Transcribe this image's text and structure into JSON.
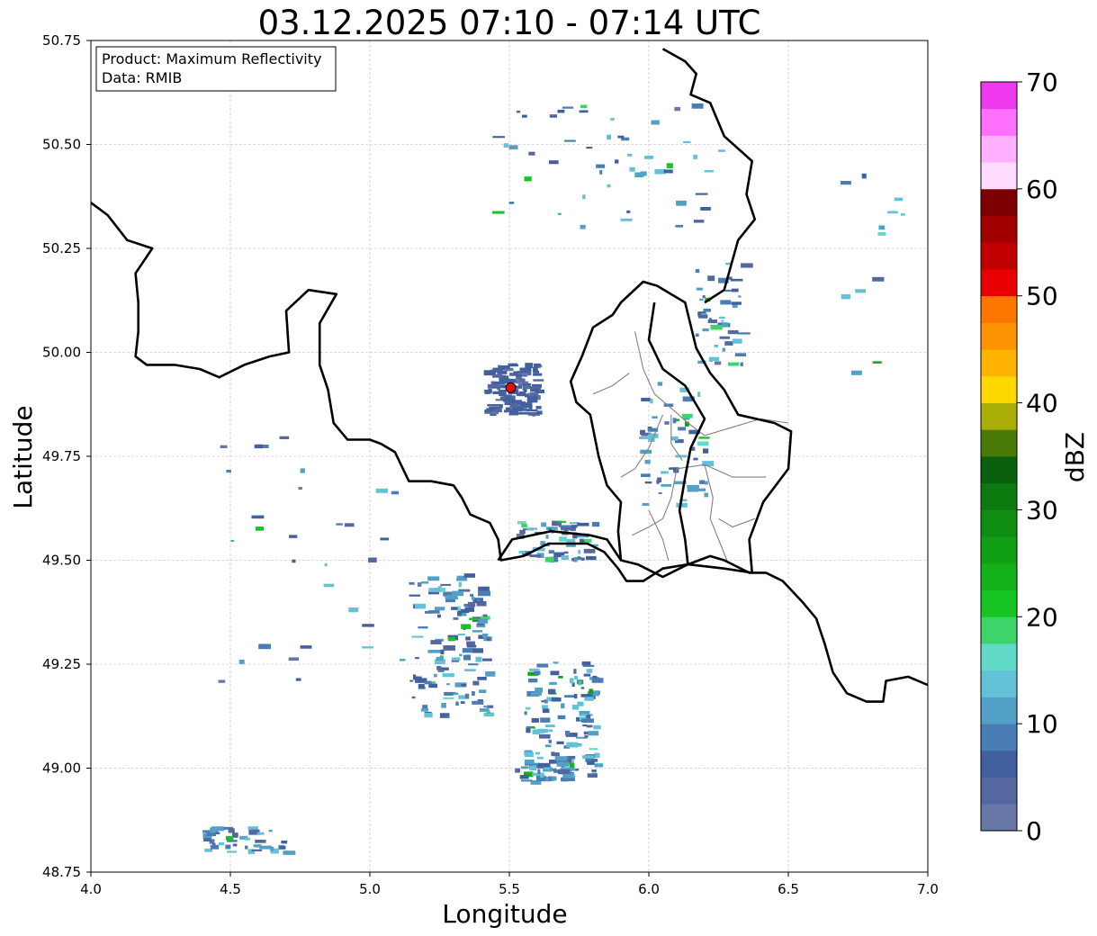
{
  "title": "03.12.2025 07:10 - 07:14 UTC",
  "info_box": {
    "product_line": "Product: Maximum Reflectivity",
    "data_line": "Data: RMIB"
  },
  "xlabel": "Longitude",
  "ylabel": "Latitude",
  "colorbar": {
    "label": "dBZ",
    "min": 0,
    "max": 70,
    "step": 2.5,
    "tick_labels": [
      "0",
      "10",
      "20",
      "30",
      "40",
      "50",
      "60",
      "70"
    ],
    "colors": [
      "#6676a6",
      "#54679f",
      "#43609e",
      "#4a7db3",
      "#53a0c6",
      "#63c2d8",
      "#61dac7",
      "#3dd46a",
      "#17c522",
      "#13b21b",
      "#11a015",
      "#0f8c12",
      "#0d7a0f",
      "#0a600c",
      "#4a7a08",
      "#a9ae06",
      "#ffd800",
      "#fdb300",
      "#fd9300",
      "#fd7600",
      "#e80000",
      "#c30000",
      "#a20000",
      "#7c0000",
      "#ffdbff",
      "#ffb0ff",
      "#ff70ff",
      "#ef39ef"
    ]
  },
  "chart_data": {
    "type": "map",
    "xlim": [
      4.0,
      7.0
    ],
    "ylim": [
      48.75,
      50.75
    ],
    "x_ticks": [
      "4.0",
      "4.5",
      "5.0",
      "5.5",
      "6.0",
      "6.5",
      "7.0"
    ],
    "y_ticks": [
      "48.75",
      "49.00",
      "49.25",
      "49.50",
      "49.75",
      "50.00",
      "50.25",
      "50.50",
      "50.75"
    ],
    "grid": true,
    "radar_site": {
      "lon": 5.505,
      "lat": 49.915,
      "color": "#e01010"
    },
    "echo_regions": [
      {
        "name": "band-southwest",
        "lon": 5.28,
        "lat": 49.3,
        "lon_span": 0.28,
        "lat_span": 0.35,
        "density": 130,
        "max_dbz": 22
      },
      {
        "name": "ring-south",
        "lon": 5.68,
        "lat": 49.12,
        "lon_span": 0.26,
        "lat_span": 0.28,
        "density": 120,
        "max_dbz": 28
      },
      {
        "name": "south-arc",
        "lon": 5.62,
        "lat": 49.0,
        "lon_span": 0.2,
        "lat_span": 0.06,
        "density": 40,
        "max_dbz": 26
      },
      {
        "name": "border-band",
        "lon": 5.65,
        "lat": 49.55,
        "lon_span": 0.3,
        "lat_span": 0.1,
        "density": 60,
        "max_dbz": 22
      },
      {
        "name": "luxembourg-cells",
        "lon": 6.08,
        "lat": 49.78,
        "lon_span": 0.24,
        "lat_span": 0.3,
        "density": 55,
        "max_dbz": 26
      },
      {
        "name": "eifel-cells",
        "lon": 6.25,
        "lat": 50.1,
        "lon_span": 0.18,
        "lat_span": 0.25,
        "density": 45,
        "max_dbz": 26
      },
      {
        "name": "clutter-site",
        "lon": 5.505,
        "lat": 49.915,
        "lon_span": 0.2,
        "lat_span": 0.12,
        "density": 120,
        "max_dbz": 6
      },
      {
        "name": "north-scatter",
        "lon": 5.8,
        "lat": 50.45,
        "lon_span": 0.9,
        "lat_span": 0.3,
        "density": 50,
        "max_dbz": 22
      },
      {
        "name": "west-scatter",
        "lon": 4.8,
        "lat": 49.5,
        "lon_span": 0.7,
        "lat_span": 0.6,
        "density": 30,
        "max_dbz": 22
      },
      {
        "name": "southwest-corner",
        "lon": 4.55,
        "lat": 48.83,
        "lon_span": 0.3,
        "lat_span": 0.06,
        "density": 40,
        "max_dbz": 22
      },
      {
        "name": "east-scatter",
        "lon": 6.8,
        "lat": 50.2,
        "lon_span": 0.25,
        "lat_span": 0.5,
        "density": 12,
        "max_dbz": 24
      }
    ],
    "borders": {
      "national": [
        [
          [
            4.0,
            50.36
          ],
          [
            4.06,
            50.33
          ],
          [
            4.13,
            50.27
          ],
          [
            4.22,
            50.25
          ],
          [
            4.16,
            50.19
          ],
          [
            4.17,
            50.12
          ],
          [
            4.17,
            50.05
          ],
          [
            4.16,
            49.99
          ],
          [
            4.2,
            49.97
          ],
          [
            4.3,
            49.97
          ],
          [
            4.39,
            49.96
          ],
          [
            4.46,
            49.94
          ],
          [
            4.55,
            49.97
          ],
          [
            4.64,
            49.99
          ],
          [
            4.71,
            50.0
          ],
          [
            4.7,
            50.1
          ],
          [
            4.78,
            50.15
          ],
          [
            4.88,
            50.14
          ],
          [
            4.82,
            50.07
          ],
          [
            4.82,
            49.97
          ],
          [
            4.85,
            49.91
          ],
          [
            4.87,
            49.83
          ],
          [
            4.92,
            49.79
          ],
          [
            5.0,
            49.79
          ],
          [
            5.04,
            49.78
          ],
          [
            5.09,
            49.76
          ],
          [
            5.14,
            49.69
          ],
          [
            5.22,
            49.69
          ],
          [
            5.3,
            49.68
          ],
          [
            5.33,
            49.65
          ],
          [
            5.36,
            49.61
          ],
          [
            5.43,
            49.59
          ],
          [
            5.46,
            49.55
          ],
          [
            5.47,
            49.5
          ],
          [
            5.55,
            49.51
          ],
          [
            5.64,
            49.54
          ],
          [
            5.7,
            49.54
          ],
          [
            5.78,
            49.54
          ],
          [
            5.84,
            49.52
          ],
          [
            5.89,
            49.48
          ],
          [
            5.92,
            49.45
          ],
          [
            5.98,
            49.45
          ],
          [
            6.05,
            49.48
          ],
          [
            6.14,
            49.49
          ],
          [
            6.22,
            49.51
          ],
          [
            6.27,
            49.5
          ],
          [
            6.36,
            49.47
          ],
          [
            6.42,
            49.47
          ],
          [
            6.48,
            49.45
          ],
          [
            6.55,
            49.4
          ],
          [
            6.6,
            49.36
          ],
          [
            6.63,
            49.3
          ],
          [
            6.66,
            49.23
          ],
          [
            6.71,
            49.18
          ],
          [
            6.78,
            49.16
          ],
          [
            6.84,
            49.16
          ],
          [
            6.85,
            49.21
          ],
          [
            6.93,
            49.22
          ],
          [
            7.0,
            49.2
          ]
        ],
        [
          [
            5.46,
            49.5
          ],
          [
            5.51,
            49.55
          ],
          [
            5.65,
            49.57
          ],
          [
            5.79,
            49.56
          ],
          [
            5.85,
            49.55
          ],
          [
            5.9,
            49.5
          ],
          [
            5.96,
            49.49
          ],
          [
            6.05,
            49.46
          ],
          [
            6.14,
            49.49
          ]
        ],
        [
          [
            6.14,
            49.49
          ],
          [
            6.27,
            49.48
          ],
          [
            6.37,
            49.47
          ]
        ],
        [
          [
            6.37,
            49.47
          ],
          [
            6.36,
            49.55
          ],
          [
            6.41,
            49.64
          ],
          [
            6.5,
            49.72
          ],
          [
            6.51,
            49.81
          ],
          [
            6.45,
            49.83
          ],
          [
            6.32,
            49.85
          ],
          [
            6.27,
            49.91
          ],
          [
            6.22,
            49.95
          ],
          [
            6.17,
            50.01
          ],
          [
            6.13,
            50.12
          ],
          [
            6.03,
            50.16
          ],
          [
            5.98,
            50.17
          ],
          [
            5.9,
            50.12
          ],
          [
            5.87,
            50.09
          ],
          [
            5.8,
            50.06
          ],
          [
            5.76,
            49.99
          ],
          [
            5.72,
            49.93
          ],
          [
            5.74,
            49.88
          ],
          [
            5.79,
            49.85
          ],
          [
            5.82,
            49.75
          ],
          [
            5.85,
            49.68
          ],
          [
            5.9,
            49.64
          ],
          [
            5.89,
            49.57
          ],
          [
            5.9,
            49.5
          ]
        ],
        [
          [
            6.2,
            50.12
          ],
          [
            6.27,
            50.15
          ],
          [
            6.32,
            50.27
          ],
          [
            6.38,
            50.32
          ],
          [
            6.35,
            50.38
          ],
          [
            6.37,
            50.46
          ],
          [
            6.27,
            50.52
          ],
          [
            6.22,
            50.6
          ],
          [
            6.15,
            50.62
          ],
          [
            6.17,
            50.67
          ],
          [
            6.13,
            50.7
          ],
          [
            6.05,
            50.73
          ]
        ],
        [
          [
            6.14,
            49.49
          ],
          [
            6.13,
            49.55
          ],
          [
            6.11,
            49.62
          ],
          [
            6.13,
            49.7
          ],
          [
            6.15,
            49.77
          ],
          [
            6.2,
            49.84
          ],
          [
            6.13,
            49.92
          ],
          [
            6.05,
            49.96
          ],
          [
            6.0,
            50.03
          ],
          [
            6.02,
            50.12
          ]
        ]
      ],
      "regional": [
        [
          [
            5.95,
            50.05
          ],
          [
            5.98,
            49.96
          ],
          [
            6.02,
            49.9
          ],
          [
            6.09,
            49.86
          ],
          [
            6.14,
            49.83
          ],
          [
            6.2,
            49.8
          ],
          [
            6.3,
            49.82
          ],
          [
            6.4,
            49.84
          ],
          [
            6.5,
            49.83
          ]
        ],
        [
          [
            5.93,
            49.95
          ],
          [
            5.87,
            49.92
          ],
          [
            5.8,
            49.9
          ]
        ],
        [
          [
            6.05,
            49.85
          ],
          [
            6.0,
            49.77
          ],
          [
            5.95,
            49.72
          ],
          [
            5.9,
            49.7
          ]
        ],
        [
          [
            6.1,
            49.72
          ],
          [
            6.2,
            49.73
          ],
          [
            6.3,
            49.7
          ],
          [
            6.42,
            49.7
          ]
        ],
        [
          [
            6.1,
            49.72
          ],
          [
            6.08,
            49.65
          ],
          [
            6.05,
            49.6
          ],
          [
            6.0,
            49.58
          ],
          [
            5.94,
            49.56
          ]
        ],
        [
          [
            6.2,
            49.73
          ],
          [
            6.23,
            49.65
          ],
          [
            6.22,
            49.6
          ],
          [
            6.25,
            49.55
          ],
          [
            6.28,
            49.5
          ]
        ],
        [
          [
            6.08,
            49.85
          ],
          [
            6.08,
            49.78
          ],
          [
            6.12,
            49.74
          ]
        ],
        [
          [
            6.0,
            49.62
          ],
          [
            6.05,
            49.55
          ],
          [
            6.07,
            49.5
          ]
        ],
        [
          [
            6.25,
            49.6
          ],
          [
            6.3,
            49.58
          ],
          [
            6.38,
            49.6
          ]
        ]
      ]
    }
  }
}
